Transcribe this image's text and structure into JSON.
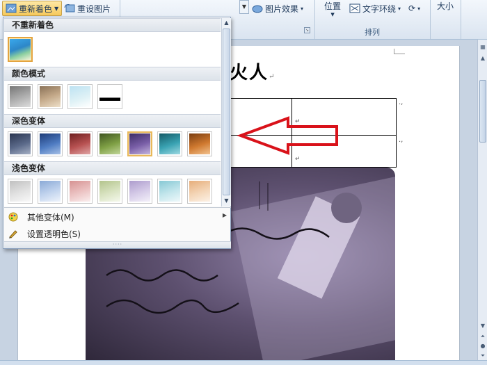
{
  "ribbon": {
    "recolor_label": "重新着色",
    "reset_label": "重设图片",
    "effects_label": "图片效果",
    "position_label": "位置",
    "wrap_label": "文字环绕",
    "size_label": "大小",
    "arrange_group_label": "排列"
  },
  "document": {
    "title_text": "火人",
    "para_mark": "↵",
    "cell_mark": "↵"
  },
  "recolor_menu": {
    "sections": [
      {
        "title": "不重新着色",
        "swatches": [
          "original"
        ]
      },
      {
        "title": "颜色模式",
        "swatches": [
          "grayscale",
          "sepia",
          "washout",
          "black-and-white"
        ]
      },
      {
        "title": "深色变体",
        "swatches": [
          "dark-blue-gray",
          "dark-blue",
          "dark-red",
          "dark-olive-green",
          "dark-purple",
          "dark-aqua",
          "dark-orange"
        ]
      },
      {
        "title": "浅色变体",
        "swatches": [
          "light-gray",
          "light-blue",
          "light-red",
          "light-olive-green",
          "light-purple",
          "light-aqua",
          "light-orange"
        ]
      }
    ],
    "selected_swatch": "original",
    "hovered_swatch": "dark-purple",
    "more_variations_label": "其他变体(M)",
    "set_transparent_label": "设置透明色(S)"
  },
  "colors": {
    "accent": "#e3a440",
    "arrow": "#d9121a",
    "photo_tint": "#5d506f",
    "original_sky": "#2f8fd0",
    "dark_purple": "#7a5fa8"
  }
}
